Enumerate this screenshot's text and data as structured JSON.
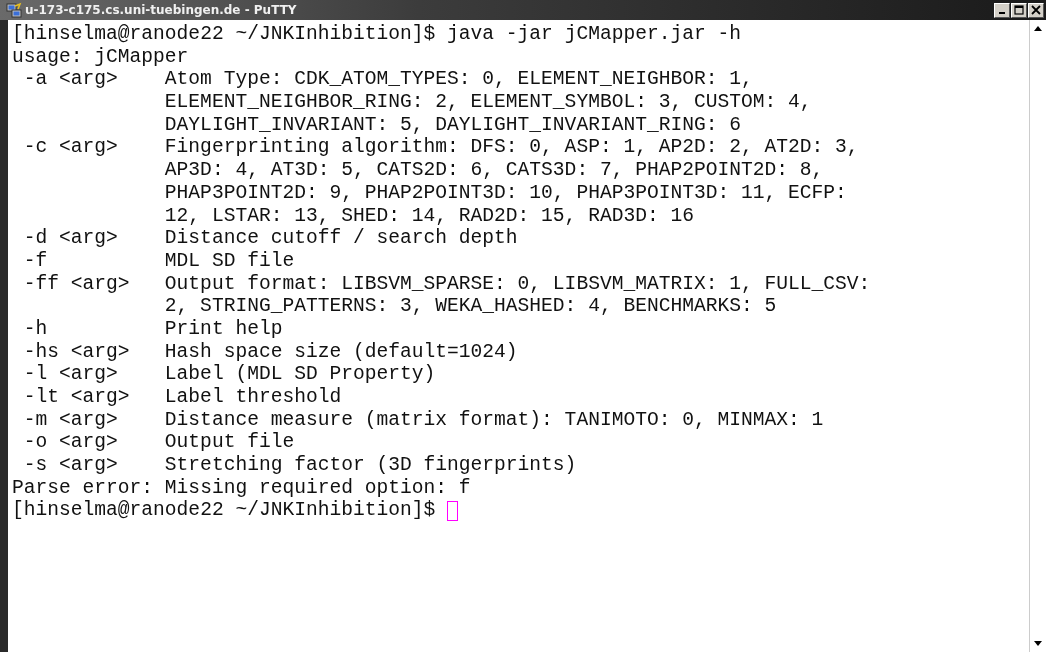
{
  "window": {
    "title": "u-173-c175.cs.uni-tuebingen.de - PuTTY"
  },
  "terminal": {
    "lines": [
      {
        "kind": "prompt",
        "text": "[hinselma@ranode22 ~/JNKInhibition]$ java -jar jCMapper.jar -h"
      },
      {
        "kind": "plain",
        "text": "usage: jCMapper"
      },
      {
        "kind": "option",
        "flag": "-a <arg>",
        "text": "Atom Type: CDK_ATOM_TYPES: 0, ELEMENT_NEIGHBOR: 1,"
      },
      {
        "kind": "option",
        "text": "ELEMENT_NEIGHBOR_RING: 2, ELEMENT_SYMBOL: 3, CUSTOM: 4,"
      },
      {
        "kind": "option",
        "text": "DAYLIGHT_INVARIANT: 5, DAYLIGHT_INVARIANT_RING: 6"
      },
      {
        "kind": "option",
        "flag": "-c <arg>",
        "text": "Fingerprinting algorithm: DFS: 0, ASP: 1, AP2D: 2, AT2D: 3,"
      },
      {
        "kind": "option",
        "text": "AP3D: 4, AT3D: 5, CATS2D: 6, CATS3D: 7, PHAP2POINT2D: 8,"
      },
      {
        "kind": "option",
        "text": "PHAP3POINT2D: 9, PHAP2POINT3D: 10, PHAP3POINT3D: 11, ECFP:"
      },
      {
        "kind": "option",
        "text": "12, LSTAR: 13, SHED: 14, RAD2D: 15, RAD3D: 16"
      },
      {
        "kind": "option",
        "flag": "-d <arg>",
        "text": "Distance cutoff / search depth"
      },
      {
        "kind": "option",
        "flag": "-f",
        "text": "MDL SD file"
      },
      {
        "kind": "option",
        "flag": "-ff <arg>",
        "text": "Output format: LIBSVM_SPARSE: 0, LIBSVM_MATRIX: 1, FULL_CSV:"
      },
      {
        "kind": "option",
        "text": "2, STRING_PATTERNS: 3, WEKA_HASHED: 4, BENCHMARKS: 5"
      },
      {
        "kind": "option",
        "flag": "-h",
        "text": "Print help"
      },
      {
        "kind": "option",
        "flag": "-hs <arg>",
        "text": "Hash space size (default=1024)"
      },
      {
        "kind": "option",
        "flag": "-l <arg>",
        "text": "Label (MDL SD Property)"
      },
      {
        "kind": "option",
        "flag": "-lt <arg>",
        "text": "Label threshold"
      },
      {
        "kind": "option",
        "flag": "-m <arg>",
        "text": "Distance measure (matrix format): TANIMOTO: 0, MINMAX: 1"
      },
      {
        "kind": "option",
        "flag": "-o <arg>",
        "text": "Output file"
      },
      {
        "kind": "option",
        "flag": "-s <arg>",
        "text": "Stretching factor (3D fingerprints)"
      },
      {
        "kind": "plain",
        "text": "Parse error: Missing required option: f"
      },
      {
        "kind": "prompt",
        "text": "[hinselma@ranode22 ~/JNKInhibition]$",
        "cursor": true
      }
    ]
  }
}
